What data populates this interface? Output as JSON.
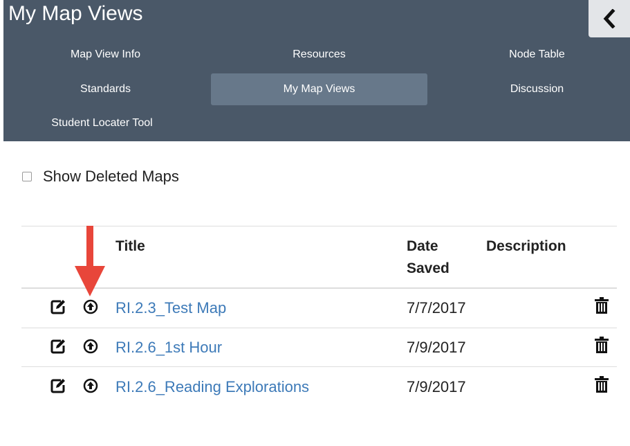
{
  "header": {
    "title": "My Map Views"
  },
  "nav": {
    "items": [
      {
        "label": "Map View Info"
      },
      {
        "label": "Resources"
      },
      {
        "label": "Node Table"
      },
      {
        "label": "Standards"
      },
      {
        "label": "My Map Views",
        "active": true
      },
      {
        "label": "Discussion"
      },
      {
        "label": "Student Locater Tool"
      }
    ]
  },
  "options": {
    "show_deleted_label": "Show Deleted Maps",
    "show_deleted_checked": false
  },
  "table": {
    "columns": {
      "title": "Title",
      "date_line1": "Date",
      "date_line2": "Saved",
      "description": "Description"
    },
    "rows": [
      {
        "title": "RI.2.3_Test Map",
        "date": "7/7/2017",
        "description": ""
      },
      {
        "title": "RI.2.6_1st Hour",
        "date": "7/9/2017",
        "description": ""
      },
      {
        "title": "RI.2.6_Reading Explorations",
        "date": "7/9/2017",
        "description": ""
      }
    ]
  },
  "colors": {
    "panel_bg": "#4a5868",
    "active_tab": "#67788a",
    "link": "#3d7ab8",
    "annotation_arrow": "#e8463a"
  },
  "icons": {
    "collapse": "chevron-left-icon",
    "edit": "edit-icon",
    "load": "upload-circle-icon",
    "delete": "trash-icon"
  }
}
